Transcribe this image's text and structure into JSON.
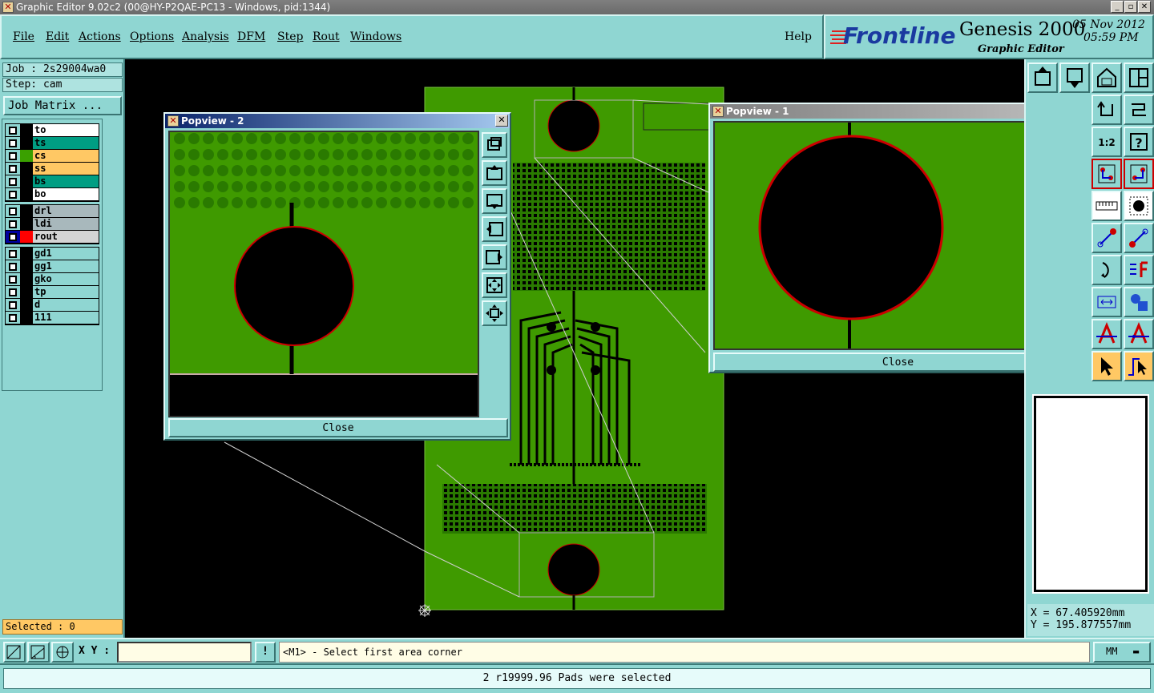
{
  "window": {
    "title": "Graphic Editor 9.02c2 (00@HY-P2QAE-PC13 - Windows, pid:1344)",
    "min": "_",
    "max": "▫",
    "close": "✕"
  },
  "menu": {
    "file": "File",
    "edit": "Edit",
    "actions": "Actions",
    "options": "Options",
    "analysis": "Analysis",
    "dfm": "DFM",
    "step": "Step",
    "rout": "Rout",
    "windows": "Windows",
    "help": "Help"
  },
  "branding": {
    "logo": "Frontline",
    "product": "Genesis 2000",
    "subtitle": "Graphic Editor",
    "date": "05 Nov 2012",
    "time": "05:59 PM"
  },
  "job": {
    "job_label": "Job : 2s29004wa0",
    "step_label": "Step: cam",
    "matrix_button": "Job Matrix ..."
  },
  "layers": {
    "group1": [
      {
        "name": "to",
        "color": "#ffffff"
      },
      {
        "name": "ts",
        "color": "#009e83"
      },
      {
        "name": "cs",
        "color": "#ffc864",
        "swatch": "#3aa000"
      },
      {
        "name": "ss",
        "color": "#ffc864"
      },
      {
        "name": "bs",
        "color": "#009e83"
      },
      {
        "name": "bo",
        "color": "#ffffff"
      }
    ],
    "group2": [
      {
        "name": "drl",
        "color": "#a8b8bc"
      },
      {
        "name": "ldi",
        "color": "#a8b8bc"
      },
      {
        "name": "rout",
        "color": "#d4d4d4",
        "swatch": "#ff0000"
      }
    ],
    "group3": [
      {
        "name": "gd1",
        "color": "#8fd6d2"
      },
      {
        "name": "gg1",
        "color": "#8fd6d2"
      },
      {
        "name": "gko",
        "color": "#8fd6d2"
      },
      {
        "name": "tp",
        "color": "#8fd6d2"
      },
      {
        "name": "d",
        "color": "#8fd6d2"
      },
      {
        "name": "111",
        "color": "#8fd6d2"
      }
    ]
  },
  "selected": "Selected : 0",
  "popview2": {
    "title": "Popview - 2",
    "close": "Close"
  },
  "popview1": {
    "title": "Popview - 1",
    "close": "Close"
  },
  "coords": {
    "x": "X = 67.405920mm",
    "y": "Y = 195.877557mm"
  },
  "bottom": {
    "xy_label": "X Y :",
    "xy_value": "",
    "alert": "!",
    "prompt": "<M1> - Select first area corner",
    "units": "MM"
  },
  "status": "2 r19999.96 Pads were selected",
  "tools": {
    "one_to_two": "1:2",
    "help": "?"
  }
}
